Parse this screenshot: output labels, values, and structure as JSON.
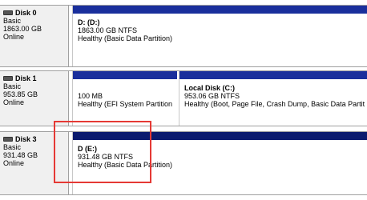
{
  "disks": [
    {
      "name": "Disk 0",
      "type": "Basic",
      "size": "1863.00 GB",
      "status": "Online",
      "partitions": [
        {
          "name": "D: (D:)",
          "size": "1863.00 GB NTFS",
          "health": "Healthy (Basic Data Partition)"
        }
      ]
    },
    {
      "name": "Disk 1",
      "type": "Basic",
      "size": "953.85 GB",
      "status": "Online",
      "partitions": [
        {
          "name": "",
          "size": "100 MB",
          "health": "Healthy (EFI System Partition"
        },
        {
          "name": "Local Disk  (C:)",
          "size": "953.06 GB NTFS",
          "health": "Healthy (Boot, Page File, Crash Dump, Basic Data Partit"
        }
      ]
    },
    {
      "name": "Disk 3",
      "type": "Basic",
      "size": "931.48 GB",
      "status": "Online",
      "partitions": [
        {
          "name": "D  (E:)",
          "size": "931.48 GB NTFS",
          "health": "Healthy (Basic Data Partition)"
        }
      ]
    }
  ],
  "colors": {
    "partition_bar": "#1a2f9c",
    "partition_bar_dark": "#0b1a6e",
    "highlight": "#e53935"
  }
}
